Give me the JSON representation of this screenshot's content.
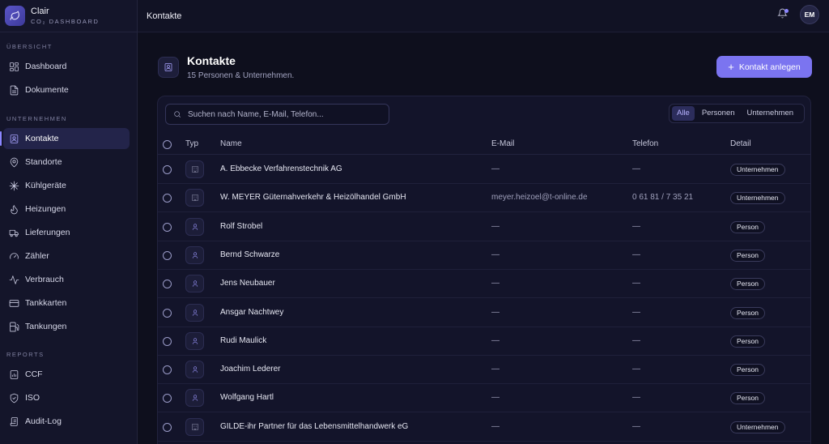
{
  "brand": {
    "name": "Clair",
    "subtitle": "CO₂ DASHBOARD"
  },
  "sidebar": {
    "sections": [
      {
        "label": "ÜBERSICHT",
        "items": [
          {
            "label": "Dashboard",
            "icon": "grid-icon"
          },
          {
            "label": "Dokumente",
            "icon": "document-icon"
          }
        ]
      },
      {
        "label": "UNTERNEHMEN",
        "items": [
          {
            "label": "Kontakte",
            "icon": "contact-card-icon",
            "active": true
          },
          {
            "label": "Standorte",
            "icon": "map-pin-icon"
          },
          {
            "label": "Kühlgeräte",
            "icon": "snowflake-icon"
          },
          {
            "label": "Heizungen",
            "icon": "flame-icon"
          },
          {
            "label": "Lieferungen",
            "icon": "truck-icon"
          },
          {
            "label": "Zähler",
            "icon": "gauge-icon"
          },
          {
            "label": "Verbrauch",
            "icon": "activity-icon"
          },
          {
            "label": "Tankkarten",
            "icon": "credit-card-icon"
          },
          {
            "label": "Tankungen",
            "icon": "fuel-icon"
          }
        ]
      },
      {
        "label": "REPORTS",
        "items": [
          {
            "label": "CCF",
            "icon": "report-icon"
          },
          {
            "label": "ISO",
            "icon": "shield-icon"
          },
          {
            "label": "Audit-Log",
            "icon": "log-icon"
          }
        ]
      }
    ]
  },
  "topbar": {
    "title": "Kontakte",
    "avatar_initials": "EM"
  },
  "page": {
    "title": "Kontakte",
    "subtitle": "15 Personen & Unternehmen.",
    "create_button": "Kontakt anlegen"
  },
  "search": {
    "placeholder": "Suchen nach Name, E-Mail, Telefon..."
  },
  "filters": {
    "all": "Alle",
    "persons": "Personen",
    "companies": "Unternehmen",
    "active": "Alle"
  },
  "table": {
    "headers": {
      "type": "Typ",
      "name": "Name",
      "email": "E-Mail",
      "phone": "Telefon",
      "detail": "Detail"
    },
    "rows": [
      {
        "type": "org",
        "name": "A. Ebbecke Verfahrenstechnik AG",
        "email": "—",
        "phone": "—",
        "detail": "Unternehmen"
      },
      {
        "type": "org",
        "name": "W. MEYER Güternahverkehr & Heizölhandel GmbH",
        "email": "meyer.heizoel@t-online.de",
        "phone": "0 61 81 / 7 35 21",
        "detail": "Unternehmen"
      },
      {
        "type": "person",
        "name": "Rolf Strobel",
        "email": "—",
        "phone": "—",
        "detail": "Person"
      },
      {
        "type": "person",
        "name": "Bernd Schwarze",
        "email": "—",
        "phone": "—",
        "detail": "Person"
      },
      {
        "type": "person",
        "name": "Jens Neubauer",
        "email": "—",
        "phone": "—",
        "detail": "Person"
      },
      {
        "type": "person",
        "name": "Ansgar Nachtwey",
        "email": "—",
        "phone": "—",
        "detail": "Person"
      },
      {
        "type": "person",
        "name": "Rudi Maulick",
        "email": "—",
        "phone": "—",
        "detail": "Person"
      },
      {
        "type": "person",
        "name": "Joachim Lederer",
        "email": "—",
        "phone": "—",
        "detail": "Person"
      },
      {
        "type": "person",
        "name": "Wolfgang Hartl",
        "email": "—",
        "phone": "—",
        "detail": "Person"
      },
      {
        "type": "org",
        "name": "GILDE-ihr Partner für das Lebensmittelhandwerk eG",
        "email": "—",
        "phone": "—",
        "detail": "Unternehmen"
      }
    ]
  },
  "colors": {
    "accent": "#7b74f0",
    "background": "#0e0f1d",
    "sidebar": "#14152a"
  }
}
